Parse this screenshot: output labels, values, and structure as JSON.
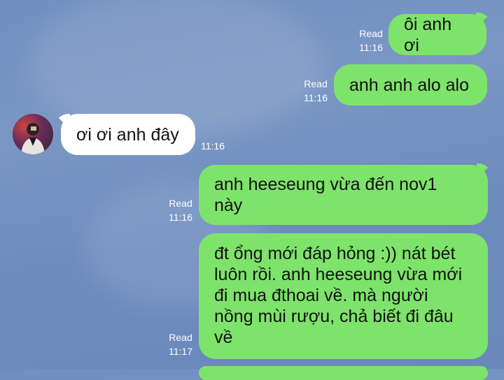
{
  "messages": [
    {
      "id": "m1",
      "direction": "out",
      "text": "ôi anh ơi",
      "read": "Read",
      "time": "11:16"
    },
    {
      "id": "m2",
      "direction": "out",
      "text": "anh anh alo alo",
      "read": "Read",
      "time": "11:16"
    },
    {
      "id": "m3",
      "direction": "in",
      "text": "ơi ơi anh đây",
      "time": "11:16"
    },
    {
      "id": "m4",
      "direction": "out",
      "text": "anh heeseung vừa đến nov1\nnày",
      "read": "Read",
      "time": "11:16"
    },
    {
      "id": "m5",
      "direction": "out",
      "text": "đt ổng mới đáp hỏng :)) nát bét\nluôn rồi. anh heeseung vừa mới\nđi mua đthoai về. mà người\nnồng mùi rượu, chả biết đi đâu\nvề",
      "read": "Read",
      "time": "11:17"
    }
  ],
  "avatar": {
    "icon": "user-avatar"
  },
  "colors": {
    "outgoing": "#7ee36b",
    "incoming": "#ffffff",
    "background": "#7090c0"
  }
}
